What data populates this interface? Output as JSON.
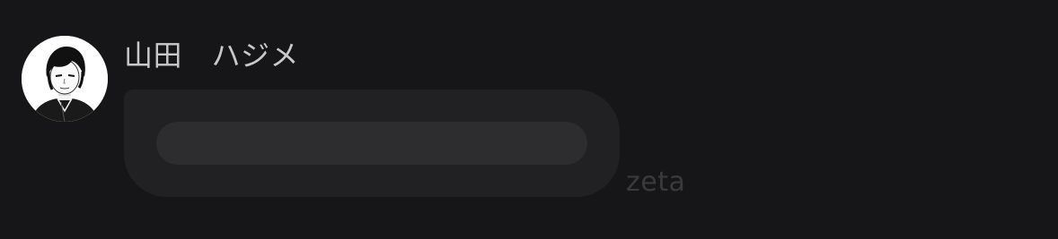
{
  "message": {
    "sender_name": "山田　ハジメ",
    "avatar": {
      "icon": "character-portrait-icon"
    },
    "content_state": "loading"
  },
  "branding": {
    "watermark": "zeta"
  },
  "colors": {
    "background": "#161618",
    "bubble": "#212123",
    "skeleton": "#2d2d2f",
    "name_text": "#c9c9cc",
    "watermark_text": "#3a3a3d"
  }
}
